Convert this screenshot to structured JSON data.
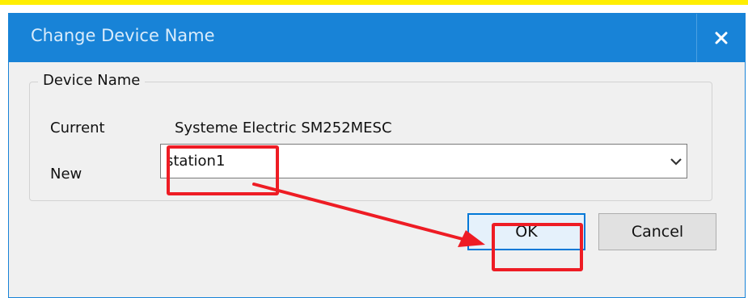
{
  "dialog": {
    "title": "Change Device Name",
    "close_glyph": "x"
  },
  "group": {
    "legend": "Device Name",
    "current_label": "Current",
    "current_value": "Systeme Electric SM252MESC",
    "new_label": "New",
    "new_value": "station1"
  },
  "buttons": {
    "ok_label": "OK",
    "cancel_label": "Cancel"
  },
  "colors": {
    "titlebar": "#1883d7",
    "annotation": "#ee1c24",
    "top_strip": "#ffee00"
  },
  "icons": {
    "close": "close-icon",
    "dropdown": "chevron-down-icon"
  }
}
